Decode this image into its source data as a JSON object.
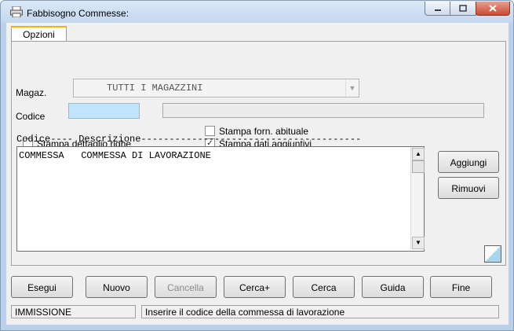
{
  "window": {
    "title": "Fabbisogno Commesse:"
  },
  "tabs": [
    {
      "label": "Opzioni"
    }
  ],
  "form": {
    "magaz_label": "Magaz.",
    "magaz_value": "TUTTI I MAGAZZINI",
    "codice_label": "Codice",
    "codice_value": "",
    "descrizione_value": "",
    "stampa_forn_label": "Stampa forn. abituale",
    "stampa_forn_checked": false,
    "stampa_dettaglio_label": "Stampa dettaglio righe",
    "stampa_dettaglio_checked": false,
    "stampa_dati_label": "Stampa dati aggiuntivi",
    "stampa_dati_checked": true
  },
  "list": {
    "header": "Codice---- Descrizione---------------------------------------",
    "items": [
      {
        "text": "COMMESSA   COMMESSA DI LAVORAZIONE"
      }
    ]
  },
  "side_buttons": {
    "aggiungi": "Aggiungi",
    "rimuovi": "Rimuovi"
  },
  "toolbar": {
    "esegui": "Esegui",
    "nuovo": "Nuovo",
    "cancella": "Cancella",
    "cerca_plus": "Cerca+",
    "cerca": "Cerca",
    "guida": "Guida",
    "fine": "Fine"
  },
  "status": {
    "mode": "IMMISSIONE",
    "message": "Inserire il codice della commessa di lavorazione"
  },
  "colors": {
    "codice_field": "#bfe4fb",
    "tab_accent": "#f5b400"
  }
}
